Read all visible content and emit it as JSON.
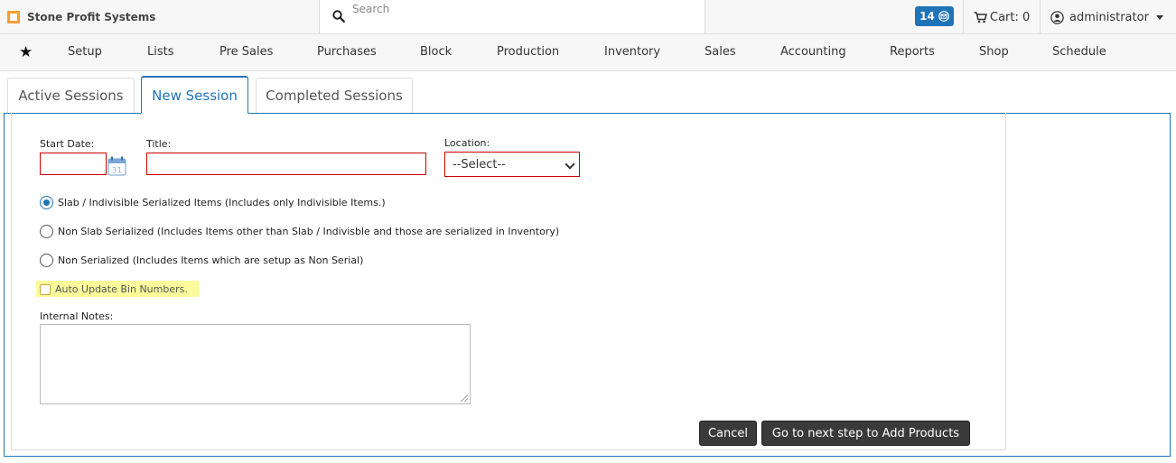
{
  "app": {
    "name": "Stone Profit Systems"
  },
  "search": {
    "placeholder": "Search"
  },
  "header": {
    "messages_count": "14",
    "cart_label": "Cart: 0",
    "user_name": "administrator"
  },
  "nav": {
    "items": [
      "Setup",
      "Lists",
      "Pre Sales",
      "Purchases",
      "Block",
      "Production",
      "Inventory",
      "Sales",
      "Accounting",
      "Reports",
      "Shop",
      "Schedule"
    ]
  },
  "tabs": [
    {
      "label": "Active Sessions",
      "active": false
    },
    {
      "label": "New Session",
      "active": true
    },
    {
      "label": "Completed Sessions",
      "active": false
    }
  ],
  "form": {
    "start_date_label": "Start Date:",
    "start_date_value": "",
    "title_label": "Title:",
    "title_value": "",
    "location_label": "Location:",
    "location_value": "--Select--",
    "radio_options": [
      {
        "label": "Slab / Indivisible Serialized Items (Includes only Indivisible Items.)",
        "checked": true
      },
      {
        "label": "Non Slab Serialized (Includes Items other than Slab / Indivisble and those are serialized in Inventory)",
        "checked": false
      },
      {
        "label": "Non Serialized (Includes Items which are setup as Non Serial)",
        "checked": false
      }
    ],
    "auto_update_label": "Auto Update Bin Numbers.",
    "auto_update_checked": false,
    "notes_label": "Internal Notes:",
    "notes_value": ""
  },
  "actions": {
    "cancel_label": "Cancel",
    "next_label": "Go to next step to Add Products"
  },
  "colors": {
    "accent": "#1f73b7",
    "required_border": "#cc0000",
    "highlight": "#fbfb9c",
    "button_dark": "#3a3a3a"
  }
}
